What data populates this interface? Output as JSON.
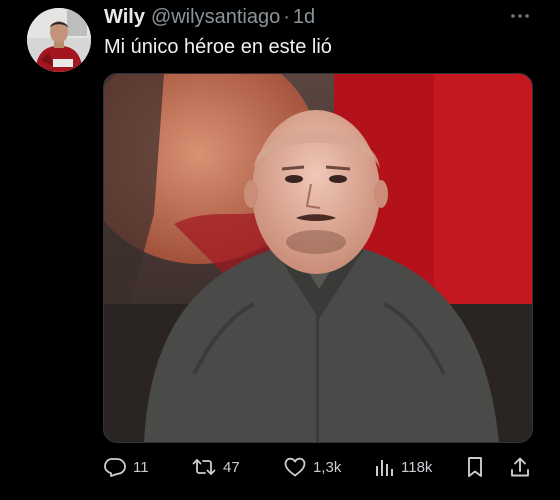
{
  "tweet": {
    "author_name": "Wily",
    "handle": "@wilysantiago",
    "separator": "·",
    "age": "1d",
    "text": "Mi único héroe en este lió"
  },
  "icons": {
    "more": "more-dots-icon",
    "reply": "reply-icon",
    "retweet": "retweet-icon",
    "like": "heart-icon",
    "views": "views-chart-icon",
    "bookmark": "bookmark-icon",
    "share": "share-icon"
  },
  "actions": {
    "replies": "11",
    "retweets": "47",
    "likes": "1,3k",
    "views": "118k"
  },
  "colors": {
    "background": "#000000",
    "text": "#e7e9ea",
    "muted": "#8b949b",
    "action": "#c9cdd1"
  }
}
